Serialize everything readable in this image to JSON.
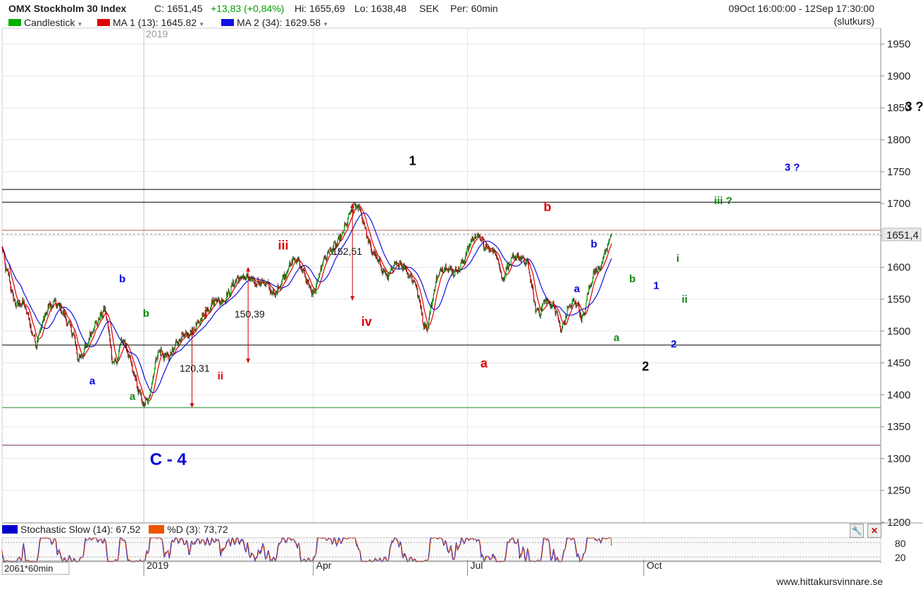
{
  "header": {
    "instrument": "OMX Stockholm 30 Index",
    "close": "C: 1651,45",
    "change": "+13,83 (+0,84%)",
    "high": "Hi: 1655,69",
    "low": "Lo: 1638,48",
    "currency": "SEK",
    "period": "Per: 60min",
    "date_range": "09Oct 16:00:00 - 12Sep 17:30:00",
    "close_type": "(slutkurs)",
    "legend": [
      {
        "label": "Candlestick",
        "color": "#00b000"
      },
      {
        "label": "MA 1 (13): 1645.82",
        "color": "#e00000"
      },
      {
        "label": "MA 2 (34): 1629.58",
        "color": "#0000e0"
      }
    ]
  },
  "colors": {
    "up": "#00aa00",
    "down": "#cc0000",
    "ma1": "#e00000",
    "ma2": "#1010e0",
    "wave_red": "#e00000",
    "wave_blue": "#0000dd",
    "wave_green": "#118811",
    "wave_black": "#000000",
    "stoch_k": "#0000cc",
    "stoch_d": "#ee5500"
  },
  "chart_data": {
    "type": "candlestick",
    "ylim": [
      1200,
      1975
    ],
    "y_ticks": [
      1200,
      1250,
      1300,
      1350,
      1400,
      1450,
      1500,
      1550,
      1600,
      1650,
      1700,
      1750,
      1800,
      1850,
      1900,
      1950
    ],
    "last_price_label": "1651,4",
    "x_labels": [
      {
        "label": "2019",
        "bar": 250
      },
      {
        "label": "Apr",
        "bar": 549
      },
      {
        "label": "Jul",
        "bar": 821
      },
      {
        "label": "Oct",
        "bar": 1132
      }
    ],
    "year_marker": {
      "label": "2019",
      "bar": 250
    },
    "bar_count_label": "2061*60min",
    "total_bars": 1550,
    "last_bar": 1075,
    "path": [
      [
        0,
        1630
      ],
      [
        6,
        1600
      ],
      [
        12,
        1585
      ],
      [
        20,
        1548
      ],
      [
        28,
        1540
      ],
      [
        36,
        1545
      ],
      [
        44,
        1530
      ],
      [
        52,
        1500
      ],
      [
        60,
        1480
      ],
      [
        70,
        1510
      ],
      [
        80,
        1535
      ],
      [
        92,
        1545
      ],
      [
        104,
        1535
      ],
      [
        116,
        1512
      ],
      [
        126,
        1495
      ],
      [
        134,
        1455
      ],
      [
        142,
        1465
      ],
      [
        150,
        1478
      ],
      [
        160,
        1505
      ],
      [
        172,
        1520
      ],
      [
        180,
        1535
      ],
      [
        186,
        1515
      ],
      [
        194,
        1455
      ],
      [
        202,
        1450
      ],
      [
        212,
        1490
      ],
      [
        220,
        1470
      ],
      [
        230,
        1440
      ],
      [
        240,
        1408
      ],
      [
        250,
        1385
      ],
      [
        260,
        1395
      ],
      [
        268,
        1440
      ],
      [
        276,
        1470
      ],
      [
        288,
        1460
      ],
      [
        298,
        1462
      ],
      [
        308,
        1482
      ],
      [
        318,
        1492
      ],
      [
        328,
        1492
      ],
      [
        340,
        1505
      ],
      [
        352,
        1520
      ],
      [
        364,
        1535
      ],
      [
        376,
        1550
      ],
      [
        388,
        1545
      ],
      [
        400,
        1560
      ],
      [
        412,
        1580
      ],
      [
        424,
        1585
      ],
      [
        436,
        1582
      ],
      [
        448,
        1575
      ],
      [
        460,
        1578
      ],
      [
        470,
        1570
      ],
      [
        480,
        1555
      ],
      [
        490,
        1572
      ],
      [
        500,
        1590
      ],
      [
        512,
        1610
      ],
      [
        522,
        1612
      ],
      [
        532,
        1590
      ],
      [
        542,
        1570
      ],
      [
        550,
        1555
      ],
      [
        556,
        1578
      ],
      [
        566,
        1610
      ],
      [
        578,
        1625
      ],
      [
        590,
        1637
      ],
      [
        602,
        1655
      ],
      [
        612,
        1680
      ],
      [
        622,
        1698
      ],
      [
        632,
        1690
      ],
      [
        640,
        1662
      ],
      [
        650,
        1630
      ],
      [
        660,
        1615
      ],
      [
        670,
        1598
      ],
      [
        680,
        1585
      ],
      [
        690,
        1600
      ],
      [
        700,
        1608
      ],
      [
        710,
        1600
      ],
      [
        720,
        1585
      ],
      [
        728,
        1578
      ],
      [
        736,
        1548
      ],
      [
        744,
        1510
      ],
      [
        750,
        1502
      ],
      [
        756,
        1535
      ],
      [
        766,
        1580
      ],
      [
        776,
        1598
      ],
      [
        786,
        1600
      ],
      [
        796,
        1592
      ],
      [
        806,
        1598
      ],
      [
        814,
        1610
      ],
      [
        822,
        1630
      ],
      [
        832,
        1647
      ],
      [
        842,
        1650
      ],
      [
        850,
        1632
      ],
      [
        860,
        1628
      ],
      [
        868,
        1625
      ],
      [
        876,
        1612
      ],
      [
        882,
        1578
      ],
      [
        890,
        1598
      ],
      [
        900,
        1612
      ],
      [
        910,
        1618
      ],
      [
        920,
        1610
      ],
      [
        928,
        1605
      ],
      [
        936,
        1560
      ],
      [
        942,
        1532
      ],
      [
        950,
        1530
      ],
      [
        958,
        1550
      ],
      [
        966,
        1542
      ],
      [
        974,
        1540
      ],
      [
        980,
        1522
      ],
      [
        986,
        1500
      ],
      [
        992,
        1515
      ],
      [
        998,
        1535
      ],
      [
        1006,
        1545
      ],
      [
        1014,
        1545
      ],
      [
        1020,
        1525
      ],
      [
        1026,
        1520
      ],
      [
        1032,
        1555
      ],
      [
        1040,
        1580
      ],
      [
        1048,
        1598
      ],
      [
        1056,
        1600
      ],
      [
        1064,
        1625
      ],
      [
        1070,
        1640
      ],
      [
        1075,
        1652
      ]
    ],
    "h_lines": [
      {
        "y": 1722,
        "color": "#000000"
      },
      {
        "y": 1702,
        "color": "#000000"
      },
      {
        "y": 1658,
        "color": "#bb6666"
      },
      {
        "y": 1652,
        "color": "#999999",
        "dashed": true
      },
      {
        "y": 1478,
        "color": "#000000"
      },
      {
        "y": 1380,
        "color": "#228822"
      },
      {
        "y": 1321,
        "color": "#773366"
      }
    ],
    "range_arrows": [
      {
        "bar": 335,
        "y1": 1380,
        "y2": 1500,
        "text": "120,31",
        "text_bar": 313,
        "text_y": 1442
      },
      {
        "bar": 434,
        "y1": 1450,
        "y2": 1600,
        "text": "150,39",
        "text_bar": 410,
        "text_y": 1527
      },
      {
        "bar": 618,
        "y1": 1548,
        "y2": 1700,
        "text": "152,51",
        "text_bar": 582,
        "text_y": 1625
      }
    ],
    "annotations": [
      {
        "text": "1",
        "bar": 724,
        "y": 1767,
        "color": "#000000",
        "size": 18
      },
      {
        "text": "3 ?",
        "bar": 1609,
        "y": 1852,
        "color": "#000000",
        "size": 18
      },
      {
        "text": "3 ?",
        "bar": 1394,
        "y": 1757,
        "color": "#0000dd",
        "size": 15
      },
      {
        "text": "iii ?",
        "bar": 1272,
        "y": 1705,
        "color": "#118811",
        "size": 15
      },
      {
        "text": "b",
        "bar": 962,
        "y": 1695,
        "color": "#e00000",
        "size": 18
      },
      {
        "text": "iii",
        "bar": 496,
        "y": 1635,
        "color": "#e00000",
        "size": 18
      },
      {
        "text": "iv",
        "bar": 643,
        "y": 1515,
        "color": "#e00000",
        "size": 18
      },
      {
        "text": "a",
        "bar": 850,
        "y": 1450,
        "color": "#e00000",
        "size": 18
      },
      {
        "text": "i",
        "bar": 359,
        "y": 1530,
        "color": "#e00000",
        "size": 18
      },
      {
        "text": "ii",
        "bar": 385,
        "y": 1430,
        "color": "#e00000",
        "size": 15
      },
      {
        "text": "b",
        "bar": 1044,
        "y": 1637,
        "color": "#0000dd",
        "size": 15
      },
      {
        "text": "a",
        "bar": 1014,
        "y": 1567,
        "color": "#0000dd",
        "size": 15
      },
      {
        "text": "1",
        "bar": 1154,
        "y": 1572,
        "color": "#0000dd",
        "size": 15
      },
      {
        "text": "2",
        "bar": 1185,
        "y": 1480,
        "color": "#0000dd",
        "size": 15
      },
      {
        "text": "b",
        "bar": 212,
        "y": 1582,
        "color": "#0000dd",
        "size": 15
      },
      {
        "text": "a",
        "bar": 159,
        "y": 1422,
        "color": "#0000dd",
        "size": 15
      },
      {
        "text": "b",
        "bar": 1112,
        "y": 1582,
        "color": "#118811",
        "size": 15
      },
      {
        "text": "a",
        "bar": 1084,
        "y": 1490,
        "color": "#118811",
        "size": 15
      },
      {
        "text": "i",
        "bar": 1192,
        "y": 1614,
        "color": "#118811",
        "size": 15
      },
      {
        "text": "ii",
        "bar": 1204,
        "y": 1550,
        "color": "#118811",
        "size": 15
      },
      {
        "text": "b",
        "bar": 254,
        "y": 1528,
        "color": "#118811",
        "size": 15
      },
      {
        "text": "a",
        "bar": 230,
        "y": 1398,
        "color": "#118811",
        "size": 15
      },
      {
        "text": "2",
        "bar": 1135,
        "y": 1445,
        "color": "#000000",
        "size": 18
      },
      {
        "text": "C - 4",
        "bar": 293,
        "y": 1299,
        "color": "#0000dd",
        "size": 24
      }
    ],
    "stochastic": {
      "title_k": "Stochastic Slow (14): 67,52",
      "title_d": "%D (3): 73,72",
      "levels": [
        80,
        20
      ],
      "last_k": 67.52,
      "last_d": 73.72
    }
  },
  "footer": {
    "url": "www.hittakursvinnare.se"
  }
}
